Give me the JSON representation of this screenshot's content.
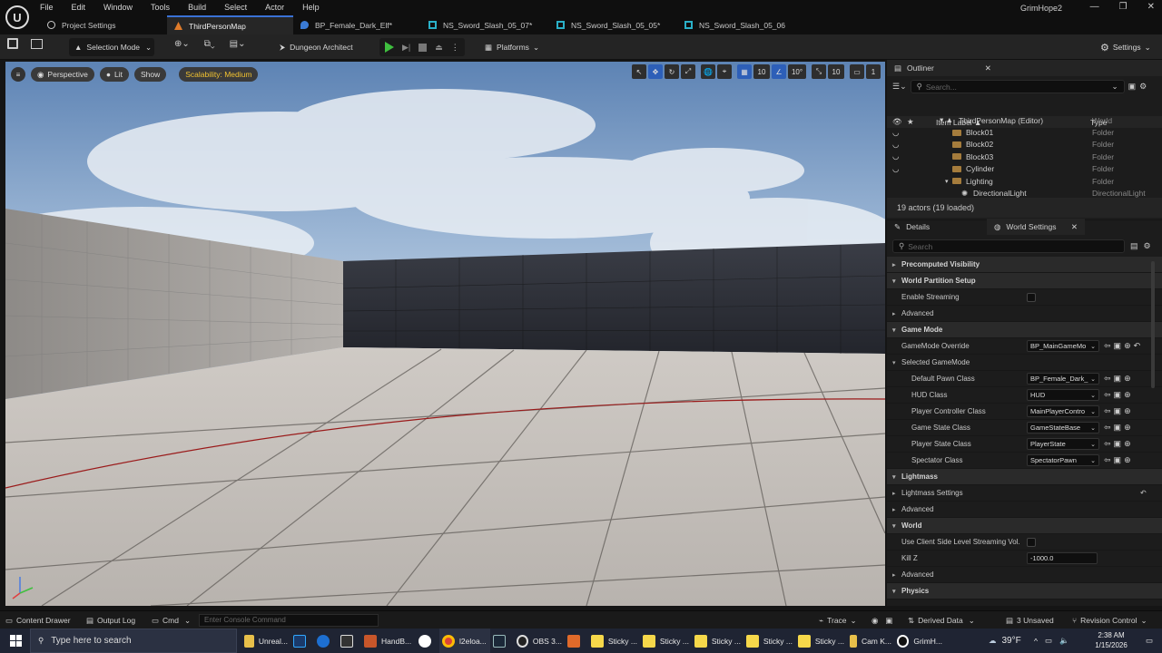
{
  "menu": {
    "items": [
      "File",
      "Edit",
      "Window",
      "Tools",
      "Build",
      "Select",
      "Actor",
      "Help"
    ]
  },
  "project_name": "GrimHope2",
  "tabs": [
    {
      "label": "Project Settings",
      "icon": "settings-icon"
    },
    {
      "label": "ThirdPersonMap",
      "icon": "level-icon"
    },
    {
      "label": "BP_Female_Dark_Elf*",
      "icon": "blueprint-icon"
    },
    {
      "label": "NS_Sword_Slash_05_07*",
      "icon": "niagara-icon"
    },
    {
      "label": "NS_Sword_Slash_05_05*",
      "icon": "niagara-icon"
    },
    {
      "label": "NS_Sword_Slash_05_06",
      "icon": "niagara-icon"
    }
  ],
  "toolbar": {
    "mode": "Selection Mode",
    "plugin": "Dungeon Architect",
    "platforms": "Platforms",
    "settings": "Settings"
  },
  "viewport": {
    "perspective": "Perspective",
    "lit": "Lit",
    "show": "Show",
    "scalability": "Scalability: Medium",
    "grid_snap": "10",
    "rot_snap": "10°",
    "scale_snap": "10",
    "cam_speed": "1"
  },
  "outliner": {
    "title": "Outliner",
    "search_placeholder": "Search...",
    "col_label": "Item Label ▲",
    "col_type": "Type",
    "rows": [
      {
        "label": "ThirdPersonMap (Editor)",
        "type": "World",
        "indent": 0
      },
      {
        "label": "Block01",
        "type": "Folder",
        "indent": 1
      },
      {
        "label": "Block02",
        "type": "Folder",
        "indent": 1
      },
      {
        "label": "Block03",
        "type": "Folder",
        "indent": 1
      },
      {
        "label": "Cylinder",
        "type": "Folder",
        "indent": 1
      },
      {
        "label": "Lighting",
        "type": "Folder",
        "indent": 1
      },
      {
        "label": "DirectionalLight",
        "type": "DirectionalLight",
        "indent": 2
      }
    ],
    "count": "19 actors (19 loaded)"
  },
  "details": {
    "tab_details": "Details",
    "tab_world": "World Settings",
    "search_placeholder": "Search",
    "sections": [
      {
        "kind": "section",
        "label": "Precomputed Visibility",
        "open": false
      },
      {
        "kind": "section",
        "label": "World Partition Setup",
        "open": true
      },
      {
        "kind": "check",
        "label": "Enable Streaming"
      },
      {
        "kind": "sub",
        "label": "Advanced"
      },
      {
        "kind": "section",
        "label": "Game Mode",
        "open": true
      },
      {
        "kind": "combo",
        "label": "GameMode Override",
        "value": "BP_MainGameMo"
      },
      {
        "kind": "subopen",
        "label": "Selected GameMode"
      },
      {
        "kind": "combo2",
        "label": "Default Pawn Class",
        "value": "BP_Female_Dark_"
      },
      {
        "kind": "combo2",
        "label": "HUD Class",
        "value": "HUD"
      },
      {
        "kind": "combo2",
        "label": "Player Controller Class",
        "value": "MainPlayerContro"
      },
      {
        "kind": "combo2",
        "label": "Game State Class",
        "value": "GameStateBase"
      },
      {
        "kind": "combo2",
        "label": "Player State Class",
        "value": "PlayerState"
      },
      {
        "kind": "combo2",
        "label": "Spectator Class",
        "value": "SpectatorPawn"
      },
      {
        "kind": "section",
        "label": "Lightmass",
        "open": true
      },
      {
        "kind": "sub",
        "label": "Lightmass Settings"
      },
      {
        "kind": "sub",
        "label": "Advanced"
      },
      {
        "kind": "section",
        "label": "World",
        "open": true
      },
      {
        "kind": "check",
        "label": "Use Client Side Level Streaming Vol."
      },
      {
        "kind": "num",
        "label": "Kill Z",
        "value": "-1000.0"
      },
      {
        "kind": "sub",
        "label": "Advanced"
      },
      {
        "kind": "section",
        "label": "Physics",
        "open": true
      }
    ]
  },
  "bottombar": {
    "content_drawer": "Content Drawer",
    "output_log": "Output Log",
    "cmd": "Cmd",
    "console_placeholder": "Enter Console Command",
    "trace": "Trace",
    "derived": "Derived Data",
    "unsaved": "3 Unsaved",
    "revision": "Revision Control"
  },
  "taskbar": {
    "search_placeholder": "Type here to search",
    "apps": [
      "Unreal...",
      "",
      "",
      "",
      "HandB...",
      "",
      "l2eloa...",
      "",
      "OBS 3...",
      "",
      "Sticky ...",
      "Sticky ...",
      "Sticky ...",
      "Sticky ...",
      "Sticky ...",
      "Cam K...",
      "GrimH..."
    ],
    "weather": "39°F",
    "time": "2:38 AM",
    "date": "1/15/2026"
  },
  "colors": {
    "accent": "#3a72d6",
    "play": "#3fbf3f",
    "folder": "#a57c3c"
  }
}
